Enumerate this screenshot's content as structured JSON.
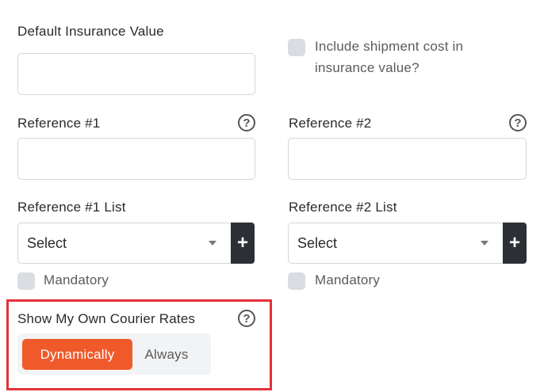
{
  "insurance": {
    "label": "Default Insurance Value",
    "value": "",
    "include_shipment_label": "Include shipment cost in insurance value?",
    "include_shipment_checked": false
  },
  "reference1": {
    "label": "Reference #1",
    "value": "",
    "help_icon": "question-circle-icon"
  },
  "reference2": {
    "label": "Reference #2",
    "value": "",
    "help_icon": "question-circle-icon"
  },
  "reference1_list": {
    "label": "Reference #1 List",
    "selected": "Select",
    "add_symbol": "+",
    "mandatory_label": "Mandatory",
    "mandatory_checked": false
  },
  "reference2_list": {
    "label": "Reference #2 List",
    "selected": "Select",
    "add_symbol": "+",
    "mandatory_label": "Mandatory",
    "mandatory_checked": false
  },
  "courier_rates": {
    "label": "Show My Own Courier Rates",
    "help_icon": "question-circle-icon",
    "options": [
      "Dynamically",
      "Always"
    ],
    "selected": "Dynamically"
  },
  "help_symbol": "?",
  "colors": {
    "accent": "#f05a2a",
    "highlight": "#e3313b",
    "dark_button": "#2c2f33"
  }
}
